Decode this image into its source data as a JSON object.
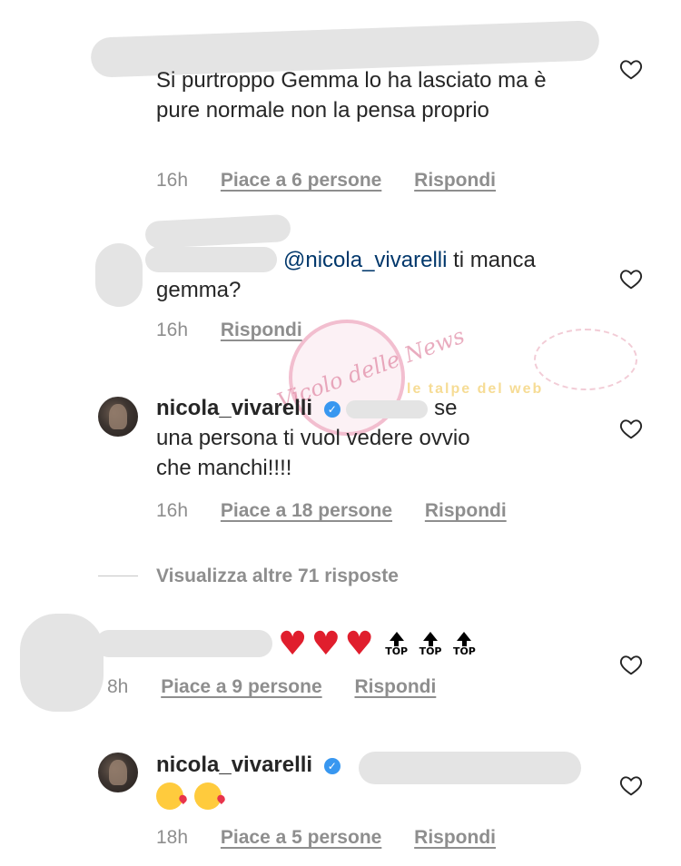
{
  "comments": [
    {
      "text": "Si purtroppo Gemma lo ha lasciato ma è pure normale non la pensa proprio",
      "time": "16h",
      "likes": "Piace a 6 persone",
      "reply": "Rispondi"
    },
    {
      "mention": "@nicola_vivarelli",
      "text": " ti manca gemma?",
      "time": "16h",
      "reply": "Rispondi"
    },
    {
      "username": "nicola_vivarelli",
      "text_part1": "se",
      "text_part2": "una persona ti vuol vedere ovvio",
      "text_part3": "che manchi!!!!",
      "time": "16h",
      "likes": "Piace a 18 persone",
      "reply": "Rispondi"
    },
    {
      "view_more": "Visualizza altre 71 risposte"
    },
    {
      "top_label": "TOP",
      "time": "8h",
      "likes": "Piace a 9 persone",
      "reply": "Rispondi"
    },
    {
      "username": "nicola_vivarelli",
      "time": "18h",
      "likes": "Piace a 5 persone",
      "reply": "Rispondi"
    }
  ],
  "watermark": {
    "text": "Vicolo delle News",
    "secondary": "le talpe del web"
  },
  "colors": {
    "text": "#262626",
    "meta": "#8e8e8e",
    "mention": "#00376b",
    "heart_red": "#e01e2d",
    "verified": "#3897f0"
  }
}
